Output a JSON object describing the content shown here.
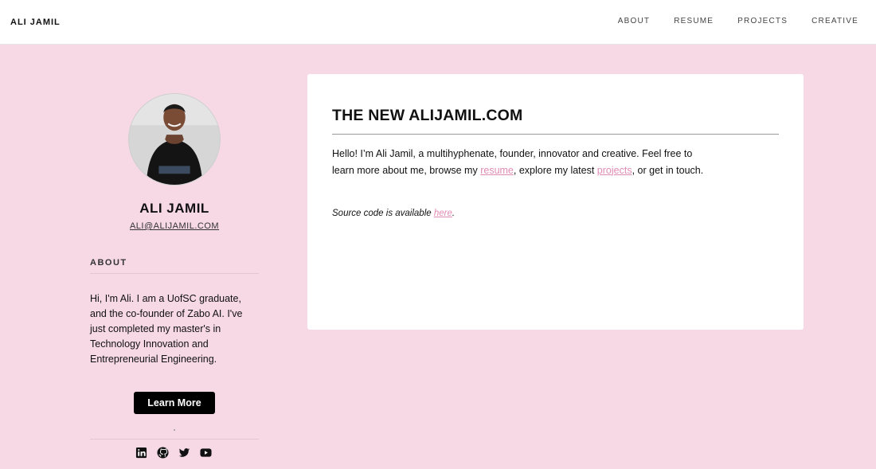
{
  "header": {
    "brand": "ALI JAMIL",
    "nav": [
      {
        "label": "ABOUT"
      },
      {
        "label": "RESUME"
      },
      {
        "label": "PROJECTS"
      },
      {
        "label": "CREATIVE"
      }
    ]
  },
  "sidebar": {
    "name": "ALI JAMIL",
    "email": "ALI@ALIJAMIL.COM",
    "about_heading": "ABOUT",
    "about_text": "Hi, I'm Ali. I am a UofSC graduate, and the co-founder of Zabo AI. I've just completed my master's in Technology Innovation and Entrepreneurial Engineering.",
    "learn_more_label": "Learn More",
    "social_icons": [
      "linkedin-icon",
      "github-icon",
      "twitter-icon",
      "youtube-icon"
    ]
  },
  "post": {
    "title": "THE NEW ALIJAMIL.COM",
    "intro_before_resume": "Hello! I’m Ali Jamil, a multihyphenate, founder, innovator and creative. Feel free to learn more about me, browse my ",
    "resume_link": "resume",
    "intro_between": ", explore my latest ",
    "projects_link": "projects",
    "intro_after": ", or get in touch.",
    "source_before": "Source code is available ",
    "source_link": "here",
    "source_after": "."
  },
  "colors": {
    "background": "#f7d9e6",
    "link": "#e08bb4",
    "button": "#000000"
  }
}
